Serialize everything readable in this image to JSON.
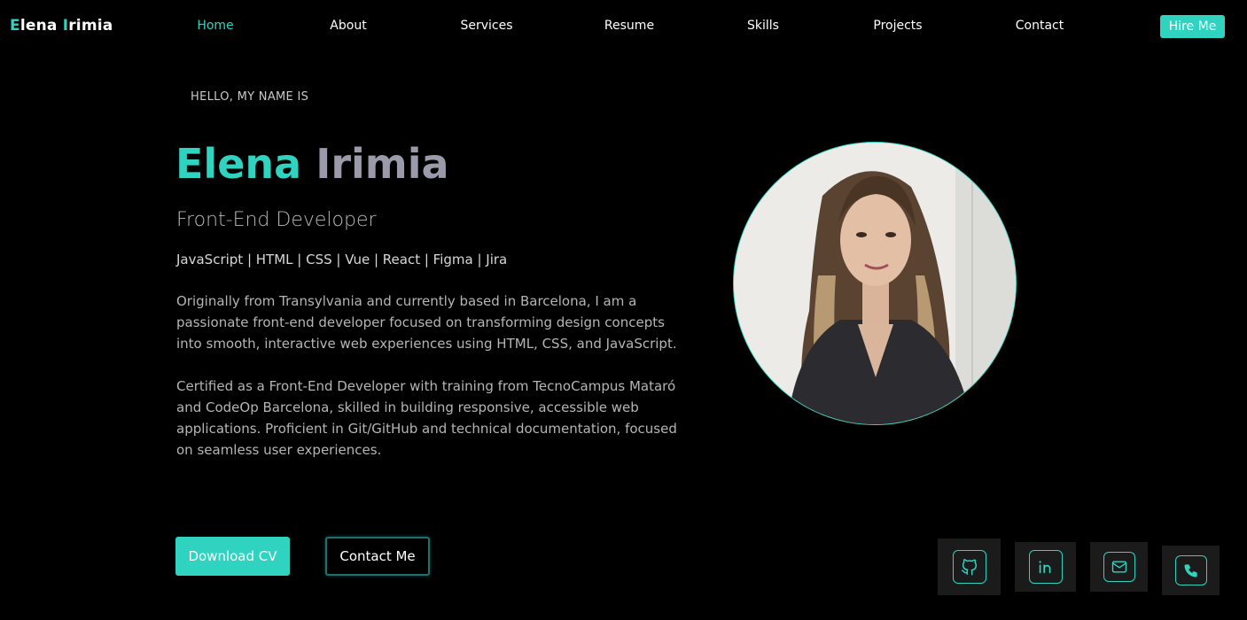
{
  "brand": {
    "first_initial": "E",
    "first_rest": "lena ",
    "last_initial": "I",
    "last_rest": "rimia"
  },
  "nav": {
    "items": [
      {
        "label": "Home",
        "active": true
      },
      {
        "label": "About",
        "active": false
      },
      {
        "label": "Services",
        "active": false
      },
      {
        "label": "Resume",
        "active": false
      },
      {
        "label": "Skills",
        "active": false
      },
      {
        "label": "Projects",
        "active": false
      },
      {
        "label": "Contact",
        "active": false
      }
    ],
    "hire_label": "Hire Me"
  },
  "hero": {
    "greeting": "HELLO, MY NAME IS",
    "first_name": "Elena",
    "last_name": "Irimia",
    "role": "Front-End Developer",
    "skills": "JavaScript | HTML | CSS | Vue | React | Figma | Jira",
    "bio_1": "Originally from Transylvania and currently based in Barcelona, I am a passionate front-end developer focused on transforming design concepts into smooth, interactive web experiences using HTML, CSS, and JavaScript.",
    "bio_2": "Certified as a Front-End Developer with training from TecnoCampus Mataró and CodeOp Barcelona, skilled in building responsive, accessible web applications. Proficient in Git/GitHub and technical documentation, focused on seamless user experiences.",
    "download_label": "Download CV",
    "contact_label": "Contact Me"
  },
  "social": [
    {
      "name": "github",
      "icon": "github-icon"
    },
    {
      "name": "linkedin",
      "icon": "linkedin-icon"
    },
    {
      "name": "email",
      "icon": "mail-icon"
    },
    {
      "name": "phone",
      "icon": "phone-icon"
    }
  ],
  "colors": {
    "accent": "#2fd3c0",
    "background": "#000000",
    "last_name": "#9a9aaa"
  }
}
